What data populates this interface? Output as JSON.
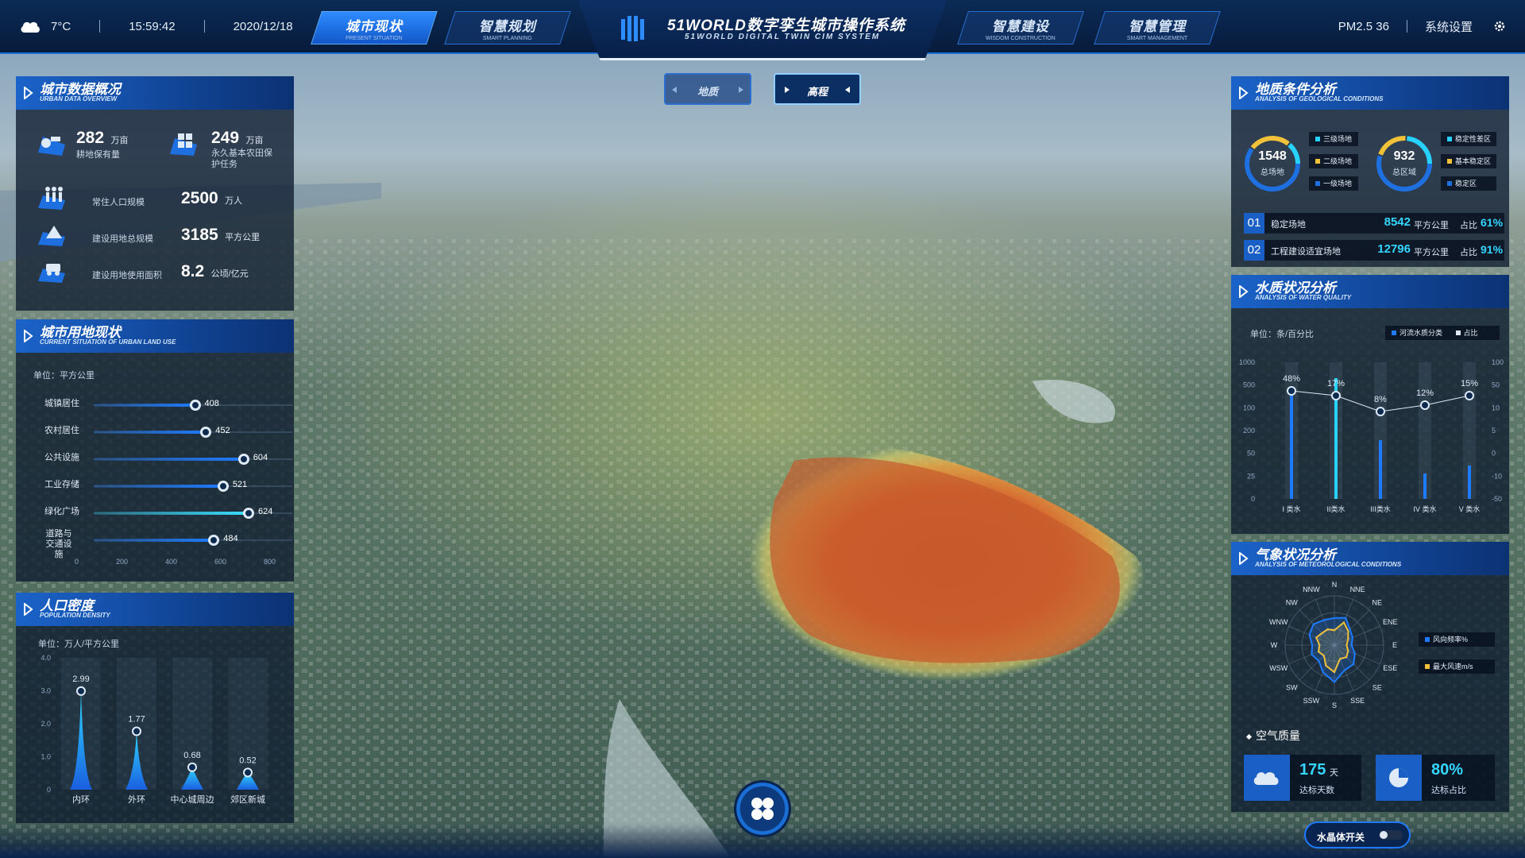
{
  "topbar": {
    "weather_icon": "cloud-icon",
    "temperature": "7°C",
    "time": "15:59:42",
    "date": "2020/12/18",
    "pm": "PM2.5 36",
    "settings": "系统设置"
  },
  "nav": {
    "tabs": [
      {
        "cn": "城市现状",
        "en": "PRESENT SITUATION",
        "active": true
      },
      {
        "cn": "智慧规划",
        "en": "SMART PLANNING",
        "active": false
      },
      {
        "cn": "智慧建设",
        "en": "WISDOM CONSTRUCTION",
        "active": false
      },
      {
        "cn": "智慧管理",
        "en": "SMART MANAGEMENT",
        "active": false
      }
    ]
  },
  "title": {
    "cn": "51WORLD数字孪生城市操作系统",
    "en": "51WORLD DIGITAL TWIN CIM SYSTEM"
  },
  "view_toggle": {
    "option1": "地质",
    "option2": "高程"
  },
  "overview": {
    "title_cn": "城市数据概况",
    "title_en": "URBAN DATA OVERVIEW",
    "farmland": {
      "value": "282",
      "unit": "万亩",
      "label": "耕地保有量"
    },
    "protect": {
      "value": "249",
      "unit": "万亩",
      "label": "永久基本农田保护任务"
    },
    "population": {
      "label": "常住人口规模",
      "value": "2500",
      "unit": "万人"
    },
    "construction": {
      "label": "建设用地总规模",
      "value": "3185",
      "unit": "平方公里"
    },
    "efficiency": {
      "label": "建设用地使用面积",
      "value": "8.2",
      "unit": "公顷/亿元"
    }
  },
  "landuse": {
    "title_cn": "城市用地现状",
    "title_en": "CURRENT SITUATION OF URBAN LAND USE",
    "unit": "单位：平方公里",
    "max": 800,
    "rows": [
      {
        "label": "城镇居住",
        "value": 408
      },
      {
        "label": "农村居住",
        "value": 452
      },
      {
        "label": "公共设施",
        "value": 604
      },
      {
        "label": "工业存储",
        "value": 521
      },
      {
        "label": "绿化广场",
        "value": 624
      },
      {
        "label": "道路与交通设施",
        "value": 484
      }
    ],
    "ticks": [
      "0",
      "200",
      "400",
      "600",
      "800"
    ]
  },
  "population": {
    "title_cn": "人口密度",
    "title_en": "POPULATION DENSITY",
    "unit": "单位：万人/平方公里"
  },
  "geology": {
    "title_cn": "地质条件分析",
    "title_en": "ANALYSIS OF GEOLOGICAL CONDITIONS",
    "ring1": {
      "value": "1548",
      "label": "总场地"
    },
    "ring2": {
      "value": "932",
      "label": "总区域"
    },
    "legend1": [
      "三级场地",
      "二级场地",
      "一级场地"
    ],
    "legend2": [
      "稳定性差区",
      "基本稳定区",
      "稳定区"
    ],
    "rows": [
      {
        "idx": "01",
        "name": "稳定场地",
        "value": "8542",
        "unit": "平方公里",
        "ratio_label": "占比",
        "ratio": "61%"
      },
      {
        "idx": "02",
        "name": "工程建设适宜场地",
        "value": "12796",
        "unit": "平方公里",
        "ratio_label": "占比",
        "ratio": "91%"
      }
    ]
  },
  "water": {
    "title_cn": "水质状况分析",
    "title_en": "ANALYSIS OF WATER QUALITY",
    "unit": "单位：条/百分比",
    "legend": [
      "河流水质分类",
      "占比"
    ]
  },
  "meteo": {
    "title_cn": "气象状况分析",
    "title_en": "ANALYSIS OF METEOROLOGICAL CONDITIONS",
    "legend": [
      "风向频率%",
      "最大风速m/s"
    ],
    "air_title": "空气质量",
    "days": {
      "value": "175",
      "unit": "天",
      "label": "达标天数"
    },
    "ratio": {
      "value": "80%",
      "label": "达标占比"
    }
  },
  "crystal": {
    "label": "水晶体开关"
  },
  "chart_data": [
    {
      "type": "bar",
      "title": "人口密度",
      "ylabel": "万人/平方公里",
      "categories": [
        "内环",
        "外环",
        "中心城周边",
        "郊区新城"
      ],
      "values": [
        2.99,
        1.77,
        0.68,
        0.52
      ],
      "value_labels": [
        "2.99",
        "1.77",
        "0.68",
        "0.52"
      ],
      "yticks": [
        "0",
        "1.0",
        "2.0",
        "3.0",
        "4.0"
      ],
      "ylim": [
        0,
        4
      ]
    },
    {
      "type": "bar",
      "title": "水质状况分析",
      "categories": [
        "I 类水",
        "II类水",
        "III类水",
        "IV 类水",
        "V 类水"
      ],
      "series": [
        {
          "name": "河流水质分类",
          "values": [
            1000,
            900,
            300,
            120,
            200
          ]
        },
        {
          "name": "占比",
          "values": [
            48,
            17,
            8,
            12,
            15
          ]
        }
      ],
      "ratio_labels": [
        "48%",
        "17%",
        "8%",
        "12%",
        "15%"
      ],
      "left_ticks": [
        "1000",
        "500",
        "100",
        "200",
        "50",
        "25",
        "0"
      ],
      "right_ticks": [
        "100",
        "50",
        "10",
        "5",
        "0",
        "-10",
        "-50"
      ]
    },
    {
      "type": "radar",
      "directions": [
        "N",
        "NNE",
        "NE",
        "ENE",
        "E",
        "ESE",
        "SE",
        "SSE",
        "S",
        "SSW",
        "SW",
        "WSW",
        "W",
        "WNW",
        "NW",
        "NNW"
      ],
      "series": [
        {
          "name": "风向频率%",
          "values": [
            0.55,
            0.6,
            0.45,
            0.4,
            0.35,
            0.45,
            0.55,
            0.55,
            0.75,
            0.6,
            0.45,
            0.5,
            0.45,
            0.55,
            0.6,
            0.55
          ]
        },
        {
          "name": "最大风速m/s",
          "values": [
            0.3,
            0.5,
            0.4,
            0.3,
            0.25,
            0.3,
            0.35,
            0.3,
            0.55,
            0.45,
            0.3,
            0.35,
            0.3,
            0.4,
            0.35,
            0.35
          ]
        }
      ]
    }
  ]
}
